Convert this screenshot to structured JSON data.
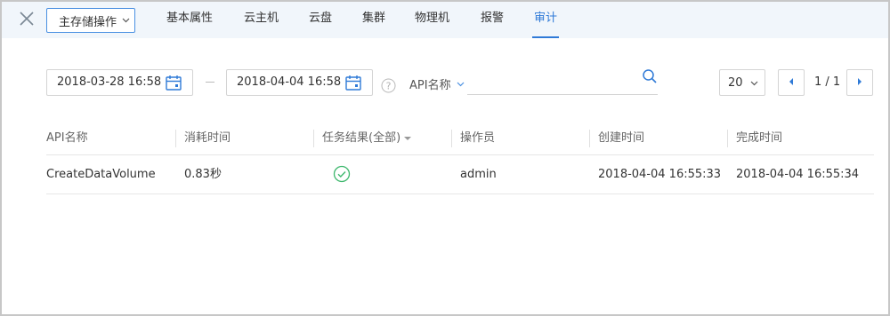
{
  "header": {
    "ops_button_label": "主存储操作",
    "tabs": [
      {
        "label": "基本属性"
      },
      {
        "label": "云主机"
      },
      {
        "label": "云盘"
      },
      {
        "label": "集群"
      },
      {
        "label": "物理机"
      },
      {
        "label": "报警"
      },
      {
        "label": "审计"
      }
    ],
    "active_tab": "审计"
  },
  "filters": {
    "start_date": "2018-03-28 16:58",
    "end_date": "2018-04-04 16:58",
    "search_field_label": "API名称",
    "search_value": "",
    "page_size": "20",
    "page_indicator": "1 / 1"
  },
  "table": {
    "columns": [
      {
        "label": "API名称"
      },
      {
        "label": "消耗时间"
      },
      {
        "label": "任务结果(全部)"
      },
      {
        "label": "操作员"
      },
      {
        "label": "创建时间"
      },
      {
        "label": "完成时间"
      }
    ],
    "rows": [
      {
        "api_name": "CreateDataVolume",
        "duration": "0.83秒",
        "result": "success",
        "operator": "admin",
        "created": "2018-04-04 16:55:33",
        "finished": "2018-04-04 16:55:34"
      }
    ]
  },
  "colors": {
    "accent": "#2f7ad7",
    "topbar_bg": "#f1f6fb",
    "success": "#3fb86e",
    "border": "#d4d4d4"
  },
  "icons": {
    "close": "close-icon",
    "calendar": "calendar-icon",
    "help": "help-icon",
    "search": "search-icon",
    "chevron": "chevron-down-icon",
    "prev": "prev-page-icon",
    "next": "next-page-icon",
    "success": "check-circle-icon"
  }
}
